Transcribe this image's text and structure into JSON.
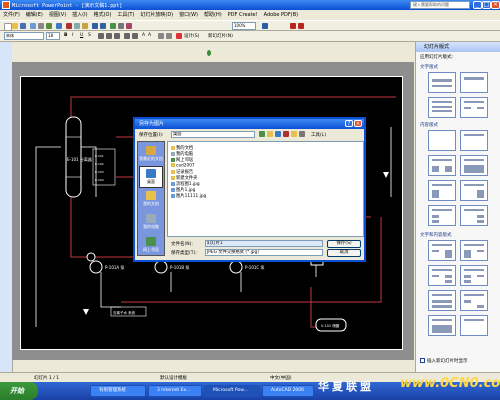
{
  "window": {
    "title": "Microsoft PowerPoint - [演示文稿1.ppt]",
    "help_placeholder": "键入需要帮助的问题"
  },
  "menubar": {
    "items": [
      "文件(F)",
      "编辑(E)",
      "视图(V)",
      "插入(I)",
      "格式(O)",
      "工具(T)",
      "幻灯片放映(D)",
      "窗口(W)",
      "帮助(H)",
      "PDF Create!",
      "Adobe PDF(B)"
    ]
  },
  "toolbar": {
    "zoom": "100%",
    "font_name": "宋体",
    "font_size": "18",
    "design_label": "设计(S)",
    "new_slide_label": "新幻灯片(N)"
  },
  "task_pane": {
    "title": "幻灯片版式",
    "apply_label": "应用幻灯片版式:",
    "sections": [
      "文字版式",
      "内容版式",
      "文字和内容版式"
    ],
    "show_checkbox_label": "插入新幻灯片时显示"
  },
  "slide": {
    "labels": {
      "column": "E-101 分离器",
      "pump1": "P-101A 泵",
      "pump2": "P-101B 泵",
      "pump3": "P-101C 泵",
      "vessel": "V-101 储罐",
      "tank": "T-101",
      "box": "去离子水 系统"
    }
  },
  "dialog": {
    "title": "另存为图片",
    "save_in_label": "保存位置(I):",
    "save_in_value": "桌面",
    "tools_label": "工具(L)",
    "places": [
      "我最近的文档",
      "桌面",
      "我的文档",
      "我的电脑",
      "网上邻居"
    ],
    "files": [
      "我的文档",
      "我的电脑",
      "网上邻居",
      "cad2007",
      "记录报告",
      "新建文件夹",
      "流程图1.jpg",
      "图片1.jpg",
      "图片11111.jpg"
    ],
    "filename_label": "文件名(N):",
    "filename_value": "幻灯片1",
    "filetype_label": "保存类型(T):",
    "filetype_value": "JPEG 文件交换格式 (*.jpg)",
    "save_button": "保存(S)",
    "cancel_button": "取消"
  },
  "statusbar": {
    "slide_info": "幻灯片 1 / 1",
    "design": "默认设计模板",
    "language": "中文(中国)"
  },
  "taskbar": {
    "start": "开始",
    "tasks": [
      "有限管理系统",
      "3 Internet Ex...",
      "Microsoft Pow...",
      "AutoCAD 2006"
    ],
    "watermark_cn": "华夏联盟",
    "watermark_url": "www.0CN0.com"
  },
  "colors": {
    "title_blue": "#0a4fd4",
    "dialog_list": "#ffffff",
    "slide_bg": "#000000",
    "pipe_red": "#c0393b",
    "pipe_white": "#ffffff"
  }
}
